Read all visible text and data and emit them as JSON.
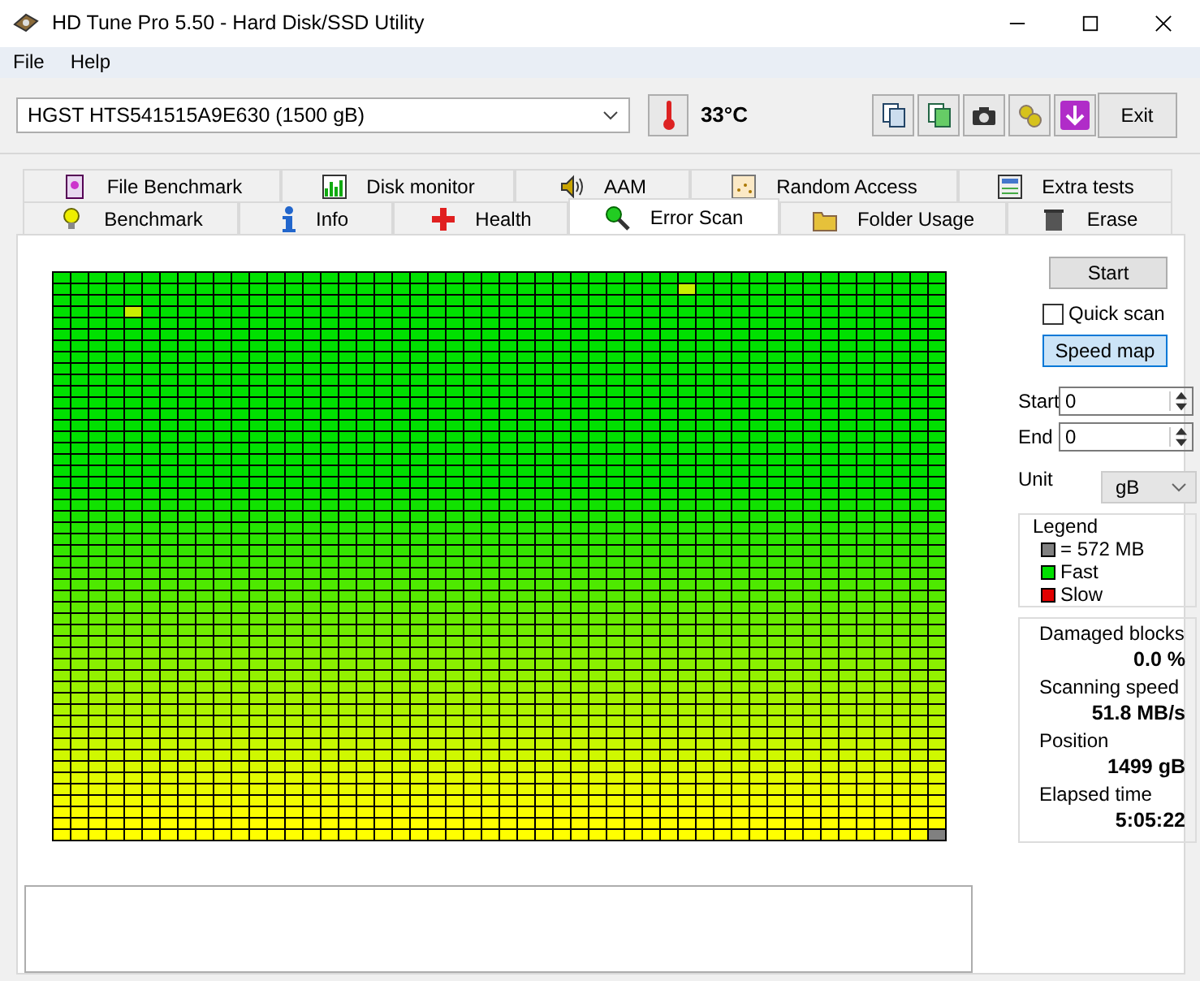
{
  "window": {
    "title": "HD Tune Pro 5.50 - Hard Disk/SSD Utility"
  },
  "menu": [
    "File",
    "Help"
  ],
  "toolbar": {
    "drive": "HGST HTS541515A9E630 (1500 gB)",
    "temperature": "33°C",
    "exit": "Exit"
  },
  "tabs": [
    [
      {
        "label": "File Benchmark",
        "selected": false
      },
      {
        "label": "Disk monitor",
        "selected": false
      },
      {
        "label": "AAM",
        "selected": false
      },
      {
        "label": "Random Access",
        "selected": false
      },
      {
        "label": "Extra tests",
        "selected": false
      }
    ],
    [
      {
        "label": "Benchmark",
        "selected": false
      },
      {
        "label": "Info",
        "selected": false
      },
      {
        "label": "Health",
        "selected": false
      },
      {
        "label": "Error Scan",
        "selected": true
      },
      {
        "label": "Folder Usage",
        "selected": false
      },
      {
        "label": "Erase",
        "selected": false
      }
    ]
  ],
  "scan": {
    "start_button": "Start",
    "quick_scan": {
      "label": "Quick scan",
      "checked": false
    },
    "speed_map": {
      "label": "Speed map",
      "selected": true
    },
    "start": {
      "label": "Start",
      "value": "0"
    },
    "end": {
      "label": "End",
      "value": "0"
    },
    "unit": {
      "label": "Unit",
      "value": "gB"
    },
    "legend": {
      "title": "Legend",
      "items": [
        {
          "label": "= 572 MB",
          "color": "#808080"
        },
        {
          "label": "Fast",
          "color": "#00e000"
        },
        {
          "label": "Slow",
          "color": "#e00000"
        }
      ]
    },
    "stats": [
      {
        "label": "Damaged blocks",
        "value": "0.0 %"
      },
      {
        "label": "Scanning speed",
        "value": "51.8 MB/s"
      },
      {
        "label": "Position",
        "value": "1499 gB"
      },
      {
        "label": "Elapsed time",
        "value": "5:05:22"
      }
    ]
  }
}
